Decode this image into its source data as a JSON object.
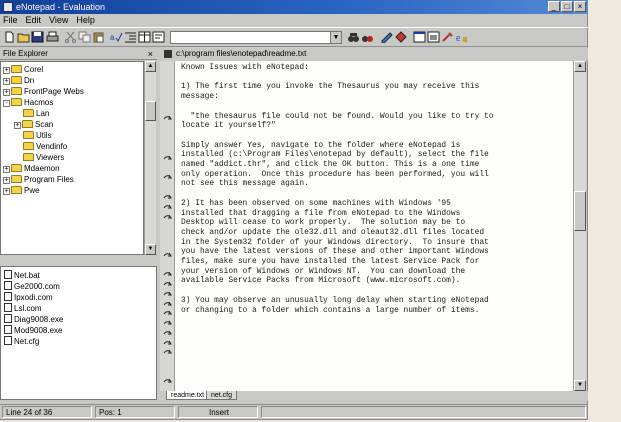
{
  "window": {
    "title": "eNotepad - Evaluation",
    "controls": [
      "_",
      "□",
      "×"
    ]
  },
  "menu": [
    "File",
    "Edit",
    "View",
    "Help"
  ],
  "toolbar": {
    "icons": [
      "new-icon",
      "open-icon",
      "save-icon",
      "print-icon",
      "cut-icon",
      "copy-icon",
      "paste-icon",
      "spell-icon",
      "indent-icon",
      "columns-icon",
      "wrap-icon",
      "binoculars-icon",
      "find-icon",
      "pen-icon",
      "color-icon",
      "window-icon",
      "window2-icon",
      "tools-icon",
      "ie-icon"
    ],
    "path_combo_value": "c:\\program files\\enotepad\\readme.txt"
  },
  "explorer": {
    "header": "File Explorer",
    "close": "×",
    "tree": [
      {
        "label": "Corel",
        "toggle": "+",
        "depth": 0
      },
      {
        "label": "Dn",
        "toggle": "+",
        "depth": 0
      },
      {
        "label": "FrontPage Webs",
        "toggle": "+",
        "depth": 0
      },
      {
        "label": "Hacmos",
        "toggle": "-",
        "depth": 0
      },
      {
        "label": "Lan",
        "toggle": "",
        "depth": 1
      },
      {
        "label": "Scan",
        "toggle": "+",
        "depth": 1
      },
      {
        "label": "Utils",
        "toggle": "",
        "depth": 1
      },
      {
        "label": "Vendinfo",
        "toggle": "",
        "depth": 1
      },
      {
        "label": "Viewers",
        "toggle": "",
        "depth": 1
      },
      {
        "label": "Mdaemon",
        "toggle": "+",
        "depth": 0
      },
      {
        "label": "Program Files",
        "toggle": "+",
        "depth": 0
      },
      {
        "label": "Pwe",
        "toggle": "+",
        "depth": 0
      }
    ],
    "files": [
      "Net.bat",
      "Ge2000.com",
      "Ipxodi.com",
      "Lsl.com",
      "Diag9008.exe",
      "Mod9008.exe",
      "Net.cfg"
    ]
  },
  "editor": {
    "path": "c:\\program files\\enotepad\\readme.txt",
    "lines": [
      "Known Issues with eNotepad:",
      "",
      "1) The first time you invoke the Thesaurus you may receive this",
      "message:",
      "",
      "  \"the thesaurus file could not be found. Would you like to try to",
      "locate it yourself?\"",
      "",
      "Simply answer Yes, navigate to the folder where eNotepad is",
      "installed (c:\\Program Files\\enotepad by default), select the file",
      "named \"addict.thr\", and click the OK button. This is a one time",
      "only operation.  Once this procedure has been performed, you will",
      "not see this message again.",
      "",
      "2) It has been observed on some machines with Windows '95",
      "installed that dragging a file from eNotepad to the Windows",
      "Desktop will cease to work properly.  The solution may be to",
      "check and/or update the ole32.dll and oleaut32.dll files located",
      "in the System32 folder of your Windows directory.  To insure that",
      "you have the latest versions of these and other important Windows",
      "files, make sure you have installed the latest Service Pack for",
      "your version of Windows or Windows NT.  You can download the",
      "available Service Packs from Microsoft (www.microsoft.com).",
      "",
      "3) You may observe an unusually long delay when starting eNotepad",
      "or changing to a folder which contains a large number of items."
    ],
    "tabs": [
      "readme.txt",
      "net.cfg"
    ]
  },
  "status": {
    "line": "Line 24 of 36",
    "pos": "Pos: 1",
    "mode": "Insert"
  }
}
